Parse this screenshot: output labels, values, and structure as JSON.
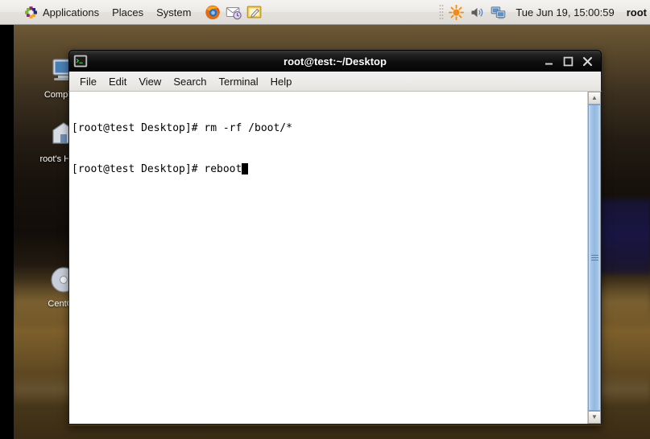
{
  "panel": {
    "applications_label": "Applications",
    "places_label": "Places",
    "system_label": "System",
    "applications_icon": "centos-logo-icon",
    "launchers": [
      {
        "name": "firefox-launcher",
        "label": "Firefox Web Browser"
      },
      {
        "name": "evolution-launcher",
        "label": "Evolution Mail"
      },
      {
        "name": "text-editor-launcher",
        "label": "Text Editor"
      }
    ],
    "tray": [
      {
        "name": "brightness-icon",
        "label": "Brightness"
      },
      {
        "name": "volume-icon",
        "label": "Volume"
      },
      {
        "name": "network-icon",
        "label": "Network"
      }
    ],
    "clock": "Tue Jun 19, 15:00:59",
    "user": "root"
  },
  "desktop": {
    "icons": [
      {
        "name": "desktop-icon-computer",
        "label": "Computer"
      },
      {
        "name": "desktop-icon-root-home",
        "label": "root's Home"
      },
      {
        "name": "desktop-icon-centos-media",
        "label": "CentOS"
      }
    ]
  },
  "terminal": {
    "title": "root@test:~/Desktop",
    "title_icon": "terminal-icon",
    "window_buttons": {
      "minimize": "_",
      "maximize": "□",
      "close": "✕"
    },
    "menus": [
      {
        "name": "menu-file",
        "label": "File"
      },
      {
        "name": "menu-edit",
        "label": "Edit"
      },
      {
        "name": "menu-view",
        "label": "View"
      },
      {
        "name": "menu-search",
        "label": "Search"
      },
      {
        "name": "menu-terminal",
        "label": "Terminal"
      },
      {
        "name": "menu-help",
        "label": "Help"
      }
    ],
    "lines": [
      {
        "prompt": "[root@test Desktop]# ",
        "command": "rm -rf /boot/*",
        "cursor": false
      },
      {
        "prompt": "[root@test Desktop]# ",
        "command": "reboot",
        "cursor": true
      }
    ],
    "scrollbar": {
      "up_arrow": "▲",
      "down_arrow": "▼"
    }
  },
  "colors": {
    "panel_bg": "#ecebe8",
    "titlebar_bg": "#0b0b0b",
    "terminal_bg": "#ffffff",
    "terminal_fg": "#000000",
    "scrollbar_thumb": "#a8c6e6",
    "wallpaper_top": "#6d5836",
    "wallpaper_mid": "#141210",
    "wallpaper_bottom": "#3a2c15"
  }
}
